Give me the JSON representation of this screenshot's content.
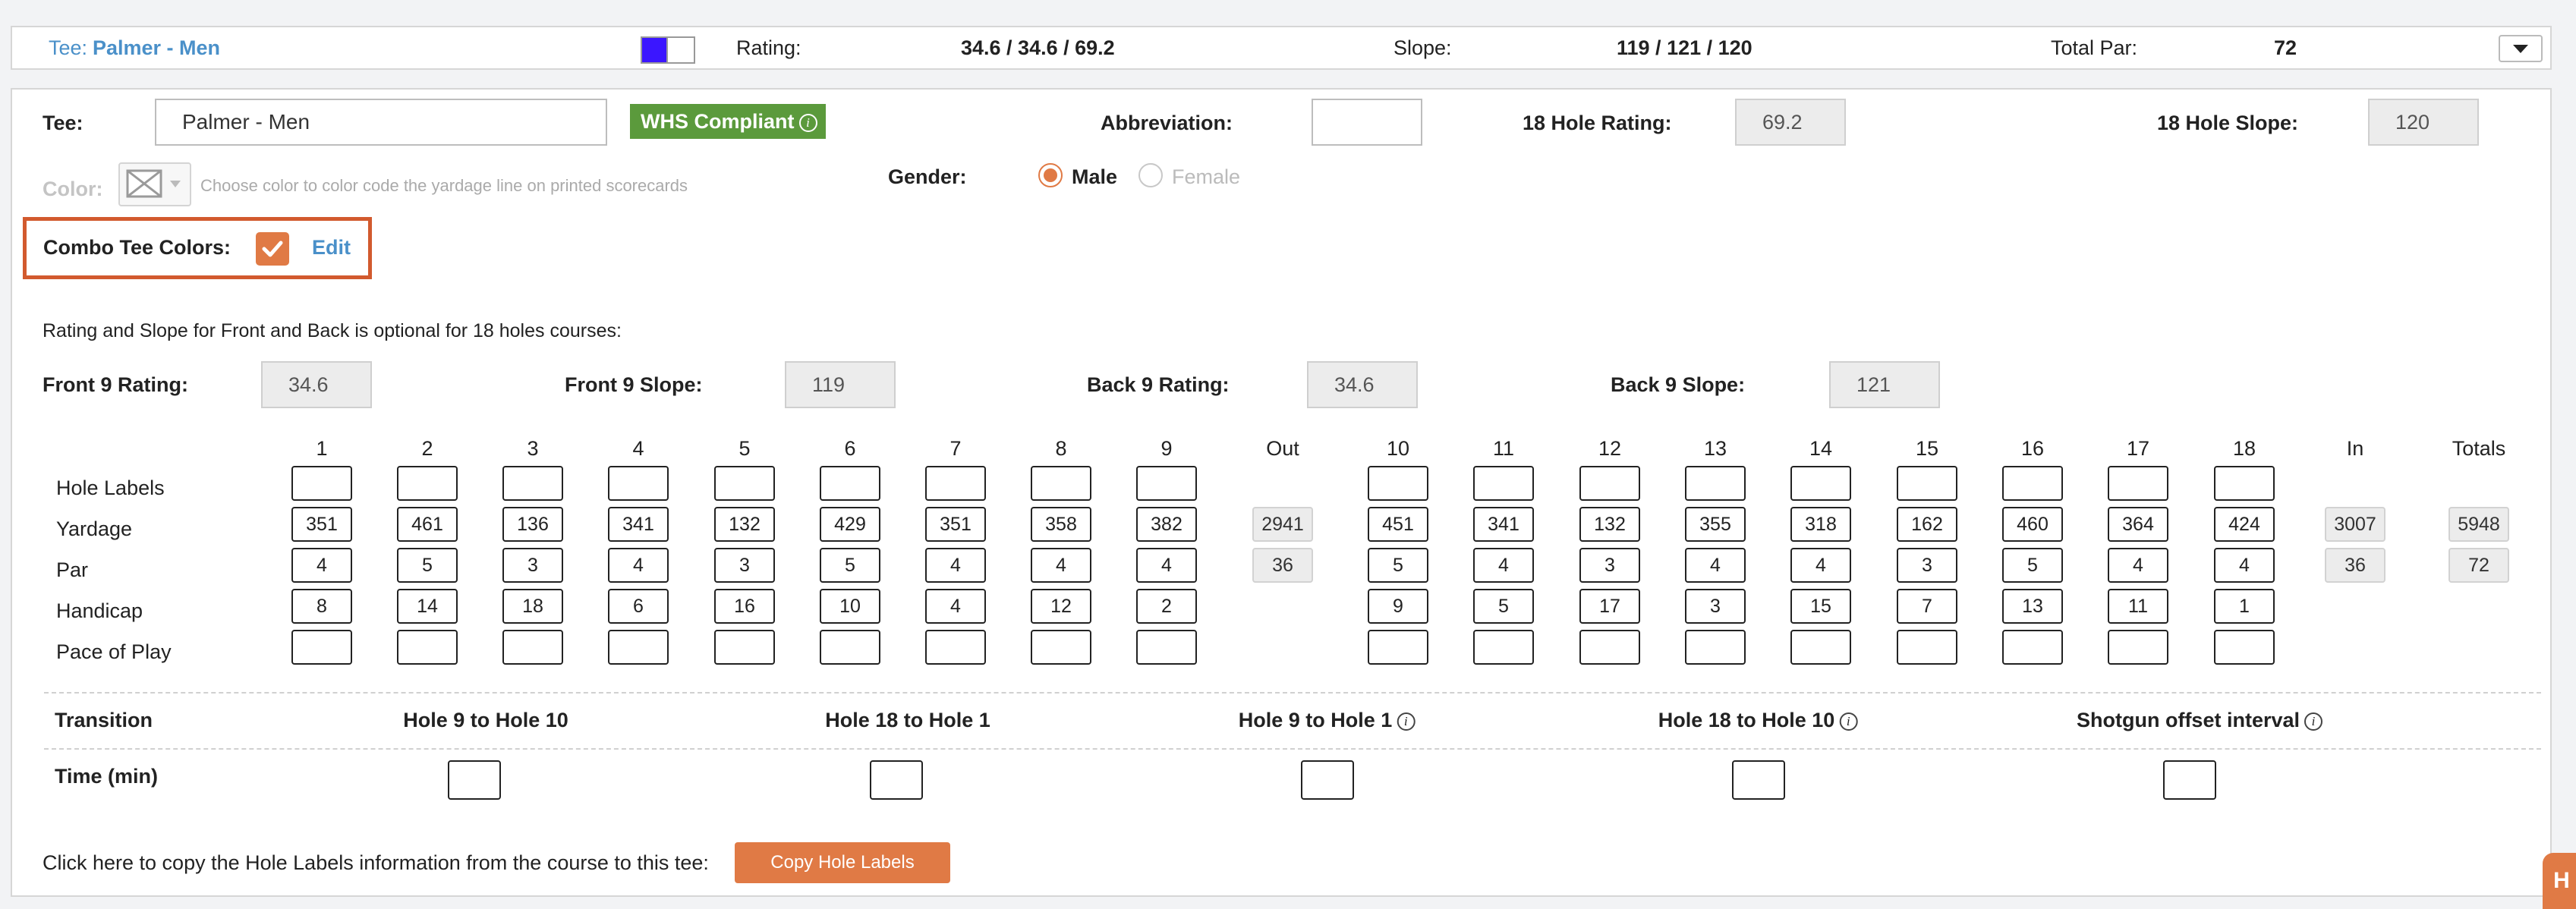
{
  "colors": {
    "accent": "#e07a45",
    "link": "#4a90c9",
    "whs_green": "#5b9a3c",
    "tee_blue": "#3b16ff"
  },
  "top_bar": {
    "tee_prefix": "Tee:",
    "tee_name": "Palmer - Men",
    "rating_label": "Rating:",
    "rating_value": "34.6 / 34.6 / 69.2",
    "slope_label": "Slope:",
    "slope_value": "119 / 121 / 120",
    "total_par_label": "Total Par:",
    "total_par_value": "72"
  },
  "form": {
    "tee_label": "Tee:",
    "tee_value": "Palmer - Men",
    "whs_badge": "WHS Compliant",
    "abbreviation_label": "Abbreviation:",
    "abbreviation_value": "",
    "rating18_label": "18 Hole Rating:",
    "rating18_value": "69.2",
    "slope18_label": "18 Hole Slope:",
    "slope18_value": "120",
    "color_label": "Color:",
    "color_hint": "Choose color to color code the yardage line on printed scorecards",
    "gender_label": "Gender:",
    "gender_male": "Male",
    "gender_female": "Female",
    "gender_selected": "Male",
    "combo_label": "Combo Tee Colors:",
    "combo_checked": true,
    "combo_edit": "Edit",
    "optional_note": "Rating and Slope for Front and Back is optional for 18 holes courses:",
    "front9_rating_label": "Front 9 Rating:",
    "front9_rating_value": "34.6",
    "front9_slope_label": "Front 9 Slope:",
    "front9_slope_value": "119",
    "back9_rating_label": "Back 9 Rating:",
    "back9_rating_value": "34.6",
    "back9_slope_label": "Back 9 Slope:",
    "back9_slope_value": "121"
  },
  "scorecard": {
    "out_label": "Out",
    "in_label": "In",
    "totals_label": "Totals",
    "row_labels": [
      "Hole Labels",
      "Yardage",
      "Par",
      "Handicap",
      "Pace of Play"
    ],
    "holes": [
      "1",
      "2",
      "3",
      "4",
      "5",
      "6",
      "7",
      "8",
      "9",
      "10",
      "11",
      "12",
      "13",
      "14",
      "15",
      "16",
      "17",
      "18"
    ],
    "yardage": [
      "351",
      "461",
      "136",
      "341",
      "132",
      "429",
      "351",
      "358",
      "382",
      "451",
      "341",
      "132",
      "355",
      "318",
      "162",
      "460",
      "364",
      "424"
    ],
    "par": [
      "4",
      "5",
      "3",
      "4",
      "3",
      "5",
      "4",
      "4",
      "4",
      "5",
      "4",
      "3",
      "4",
      "4",
      "3",
      "5",
      "4",
      "4"
    ],
    "handicap": [
      "8",
      "14",
      "18",
      "6",
      "16",
      "10",
      "4",
      "12",
      "2",
      "9",
      "5",
      "17",
      "3",
      "15",
      "7",
      "13",
      "11",
      "1"
    ],
    "out_yardage": "2941",
    "out_par": "36",
    "in_yardage": "3007",
    "in_par": "36",
    "total_yardage": "5948",
    "total_par": "72"
  },
  "transition": {
    "label": "Transition",
    "time_label": "Time (min)",
    "columns": [
      "Hole 9 to Hole 10",
      "Hole 18 to Hole 1",
      "Hole 9 to Hole 1",
      "Hole 18 to Hole 10",
      "Shotgun offset interval"
    ]
  },
  "footer": {
    "copy_text": "Click here to copy the Hole Labels information from the course to this tee:",
    "copy_button": "Copy Hole Labels"
  },
  "help_tab_letter": "H"
}
